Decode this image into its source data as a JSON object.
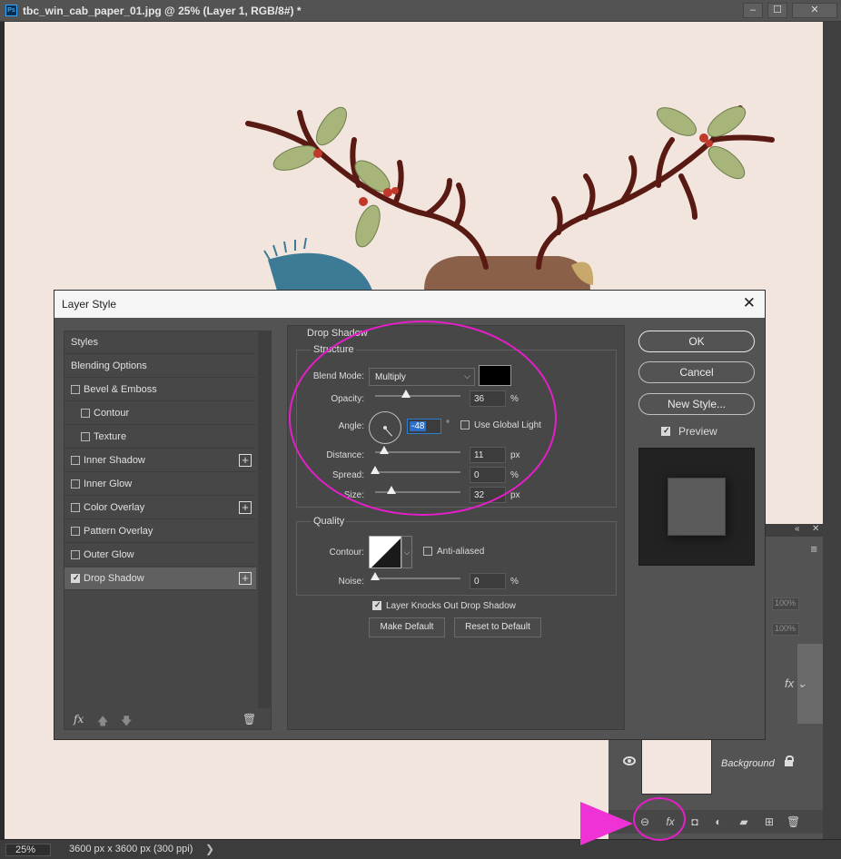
{
  "window": {
    "title": "tbc_win_cab_paper_01.jpg @ 25% (Layer 1, RGB/8#) *",
    "app_icon": "Ps",
    "controls": [
      "minimize",
      "maximize",
      "close"
    ]
  },
  "status": {
    "zoom": "25%",
    "dimensions": "3600 px x 3600 px (300 ppi)",
    "arrow": "❯"
  },
  "dialog": {
    "title": "Layer Style",
    "close": "✕",
    "styles_list": [
      {
        "label": "Styles",
        "checkbox": false,
        "plus": false
      },
      {
        "label": "Blending Options",
        "checkbox": false,
        "plus": false
      },
      {
        "label": "Bevel & Emboss",
        "checkbox": true,
        "checked": false,
        "plus": false
      },
      {
        "label": "Contour",
        "checkbox": true,
        "checked": false,
        "plus": false,
        "indent": true
      },
      {
        "label": "Texture",
        "checkbox": true,
        "checked": false,
        "plus": false,
        "indent": true
      },
      {
        "label": "Inner Shadow",
        "checkbox": true,
        "checked": false,
        "plus": true
      },
      {
        "label": "Inner Glow",
        "checkbox": true,
        "checked": false,
        "plus": false
      },
      {
        "label": "Color Overlay",
        "checkbox": true,
        "checked": false,
        "plus": true
      },
      {
        "label": "Pattern Overlay",
        "checkbox": true,
        "checked": false,
        "plus": false
      },
      {
        "label": "Outer Glow",
        "checkbox": true,
        "checked": false,
        "plus": false
      },
      {
        "label": "Drop Shadow",
        "checkbox": true,
        "checked": true,
        "plus": true,
        "active": true
      }
    ],
    "footer": {
      "fx": "fx",
      "up": "🡅",
      "down": "🡇",
      "trash": "🗑"
    },
    "drop_shadow": {
      "legend": "Drop Shadow",
      "structure_legend": "Structure",
      "blend_mode_label": "Blend Mode:",
      "blend_mode": "Multiply",
      "shadow_color": "#000000",
      "opacity_label": "Opacity:",
      "opacity": "36",
      "opacity_unit": "%",
      "opacity_level": 36,
      "angle_label": "Angle:",
      "angle": "-48",
      "angle_unit": "°",
      "use_global_light": "Use Global Light",
      "distance_label": "Distance:",
      "distance": "11",
      "distance_unit": "px",
      "distance_level": 11,
      "spread_label": "Spread:",
      "spread": "0",
      "spread_unit": "%",
      "spread_level": 0,
      "size_label": "Size:",
      "size": "32",
      "size_unit": "px",
      "size_level": 19,
      "quality_legend": "Quality",
      "contour_label": "Contour:",
      "anti_aliased": "Anti-aliased",
      "noise_label": "Noise:",
      "noise": "0",
      "noise_unit": "%",
      "noise_level": 0,
      "knockout": "Layer Knocks Out Drop Shadow",
      "make_default": "Make Default",
      "reset_default": "Reset to Default"
    },
    "buttons": {
      "ok": "OK",
      "cancel": "Cancel",
      "new_style": "New Style...",
      "preview": "Preview"
    }
  },
  "layers_panel": {
    "collapse": "«",
    "close": "✕",
    "menu": "≡",
    "opacity_a": "100%",
    "opacity_b": "100%",
    "layer_fx": "fx",
    "layer_fx_chevron": "⌄",
    "background_name": "Background",
    "bottom_icons": {
      "link": "⊖",
      "fx": "fx",
      "mask": "◘",
      "adjust": "◐",
      "folder": "▰",
      "new": "⊞",
      "trash": "🗑"
    }
  },
  "colors": {
    "annotation": "#e61ec9",
    "canvas": "#f1e5dd",
    "antler": "#5a1a14",
    "holly": "#a7b57a",
    "berry": "#c0392b"
  }
}
